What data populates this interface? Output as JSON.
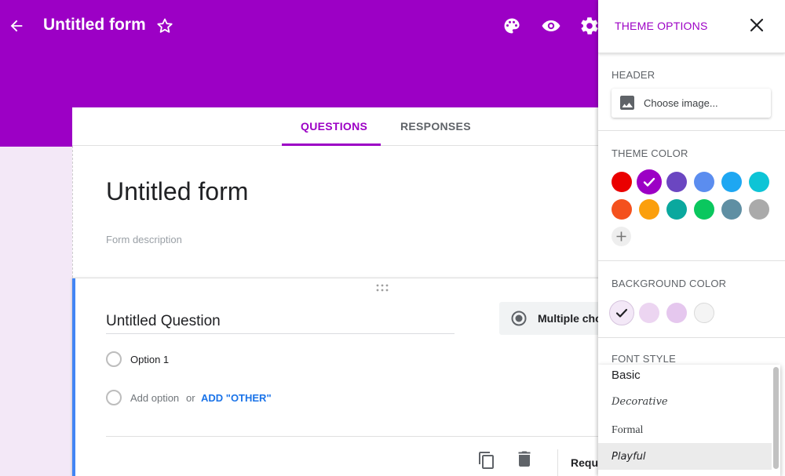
{
  "header": {
    "title": "Untitled form",
    "icons": [
      "back-arrow-icon",
      "star-icon",
      "palette-icon",
      "eye-icon",
      "gear-icon"
    ]
  },
  "form": {
    "tabs": [
      {
        "label": "QUESTIONS",
        "active": true
      },
      {
        "label": "RESPONSES",
        "active": false
      }
    ],
    "title": "Untitled form",
    "description_placeholder": "Form description"
  },
  "question": {
    "title": "Untitled Question",
    "type_label": "Multiple cho",
    "options": [
      "Option 1"
    ],
    "add_option_label": "Add option",
    "or_label": "or",
    "add_other_label": "ADD \"OTHER\"",
    "required_label": "Requi"
  },
  "theme_panel": {
    "title": "THEME OPTIONS",
    "header_label": "HEADER",
    "choose_image_label": "Choose image...",
    "theme_color_label": "THEME COLOR",
    "theme_colors": [
      "#ea0000",
      "#9c00c5",
      "#6b46c1",
      "#5b8def",
      "#1ea7f2",
      "#0ec4d6",
      "#f4511e",
      "#fb9f0d",
      "#0aa89e",
      "#0ac75e",
      "#5f8fa3",
      "#aaaaaa"
    ],
    "selected_theme_color": "#9c00c5",
    "background_color_label": "BACKGROUND COLOR",
    "background_colors": [
      "#f3e8f7",
      "#ecd5f1",
      "#e5c7ee",
      "#f4f4f4"
    ],
    "selected_background_color": "#f3e8f7",
    "font_style_label": "FONT STYLE",
    "font_options": [
      "Basic",
      "Decorative",
      "Formal",
      "Playful"
    ],
    "highlighted_font": "Playful"
  },
  "colors": {
    "accent": "#9c00c5",
    "link": "#1a73e8",
    "question_accent": "#4285f4"
  }
}
